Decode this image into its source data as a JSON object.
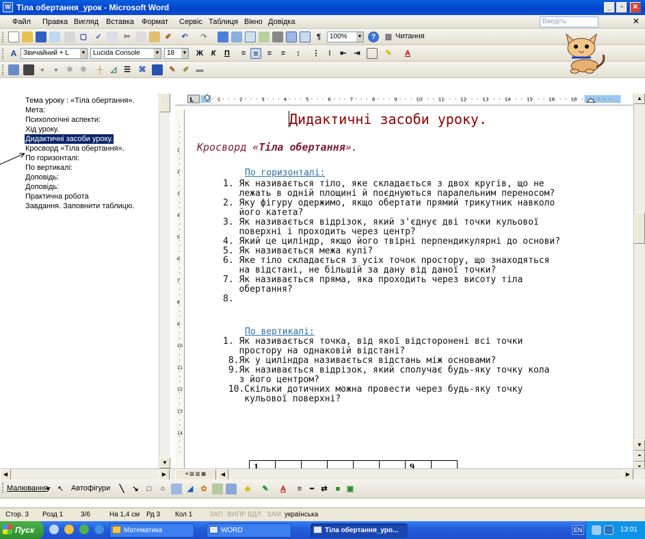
{
  "window": {
    "title": "Тіла обертання_урок - Microsoft Word"
  },
  "menu": {
    "items": [
      "Файл",
      "Правка",
      "Вигляд",
      "Вставка",
      "Формат",
      "Сервіс",
      "Таблиця",
      "Вікно",
      "Довідка"
    ],
    "ask_placeholder": "Введіть запитання"
  },
  "toolbar": {
    "zoom": "100%",
    "read_label": "Читання",
    "style": "Звичайний + L",
    "font": "Lucida Console",
    "size": "18"
  },
  "docmap": {
    "items": [
      "Тема уроку : «Тіла обертання».",
      "Мета:",
      "Психологічні аспекти:",
      "Хід уроку.",
      "Дидактичні засоби уроку.",
      "Кросворд «Тіла обертання».",
      "По горизонталі:",
      "По вертикалі:",
      "Доповідь:",
      "Доповідь:",
      "Практична робота",
      "Завдання. Заповнити таблицю."
    ],
    "selected_index": 4
  },
  "ruler": {
    "numbers": [
      "1",
      "2",
      "3",
      "4",
      "5",
      "6",
      "7",
      "8",
      "9",
      "10",
      "11",
      "12",
      "13",
      "14",
      "15",
      "16",
      "18"
    ]
  },
  "vruler": {
    "numbers": [
      "1",
      "2",
      "3",
      "4",
      "5",
      "6",
      "7",
      "8",
      "9",
      "10",
      "11",
      "12",
      "13",
      "14"
    ]
  },
  "document": {
    "heading": "Дидактичні засоби уроку.",
    "crossword_prefix": "Кросворд «",
    "crossword_name": "Тіла обертання",
    "crossword_suffix": "».",
    "horizontal_title": "По горизонталі:",
    "horizontal_lines": [
      "1. Як називається тіло, яке складається з двох кругів, що не",
      "   лежать в одній площині й поєднуються паралельним переносом?",
      "2. Яку фігуру одержимо, якщо обертати прямий трикутник навколо",
      "   його катета?",
      "3. Як називається відрізок, який з'єднує дві точки кульової",
      "   поверхні і проходить через центр?",
      "4. Який це циліндр, якщо його твірні перпендикулярні до основи?",
      "5. Як називається межа кулі?",
      "6. Яке тіло складається з усіх точок простору, що знаходяться",
      "   на відстані, не більшій за дану від даної точки?",
      "7. Як називається пряма, яка проходить через висоту тіла",
      "   обертання?",
      "8."
    ],
    "vertical_title": "По вертикалі:",
    "vertical_lines": [
      "1. Як називається точка, від якої відсторонені всі точки",
      "   простору на однаковій відстані?",
      " 8.Як у циліндра називається відстань між основами?",
      " 9.Як називається відрізок, який сполучає будь-яку точку кола",
      "   з його центром?",
      " 10.Скільки дотичних можна провести через будь-яку точку",
      "    кульової поверхні?"
    ],
    "crossword_row": [
      "1",
      "",
      "",
      "",
      "",
      "",
      "9",
      ""
    ]
  },
  "drawing": {
    "draw_label": "Малювання",
    "autoshapes_label": "Автофігури"
  },
  "status": {
    "page": "Стор. 3",
    "section": "Розд 1",
    "pages": "3/6",
    "at": "На 1,4 см",
    "line": "Рд 3",
    "col": "Кол 1",
    "rec": "ЗАП",
    "trk": "ВИПР",
    "ext": "ВДЛ",
    "ovr": "ЗАМ",
    "lang": "українська"
  },
  "taskbar": {
    "start": "Пуск",
    "tasks": [
      "Математика",
      "WORD",
      "Тіла обертання_уро..."
    ],
    "lang": "EN",
    "time": "13:01"
  },
  "colors": {
    "heading": "#8b0000",
    "crossword": "#7a1a3a",
    "link": "#2a6fa8",
    "selection": "#0a246a",
    "title_bar": "#0a5fe0"
  }
}
